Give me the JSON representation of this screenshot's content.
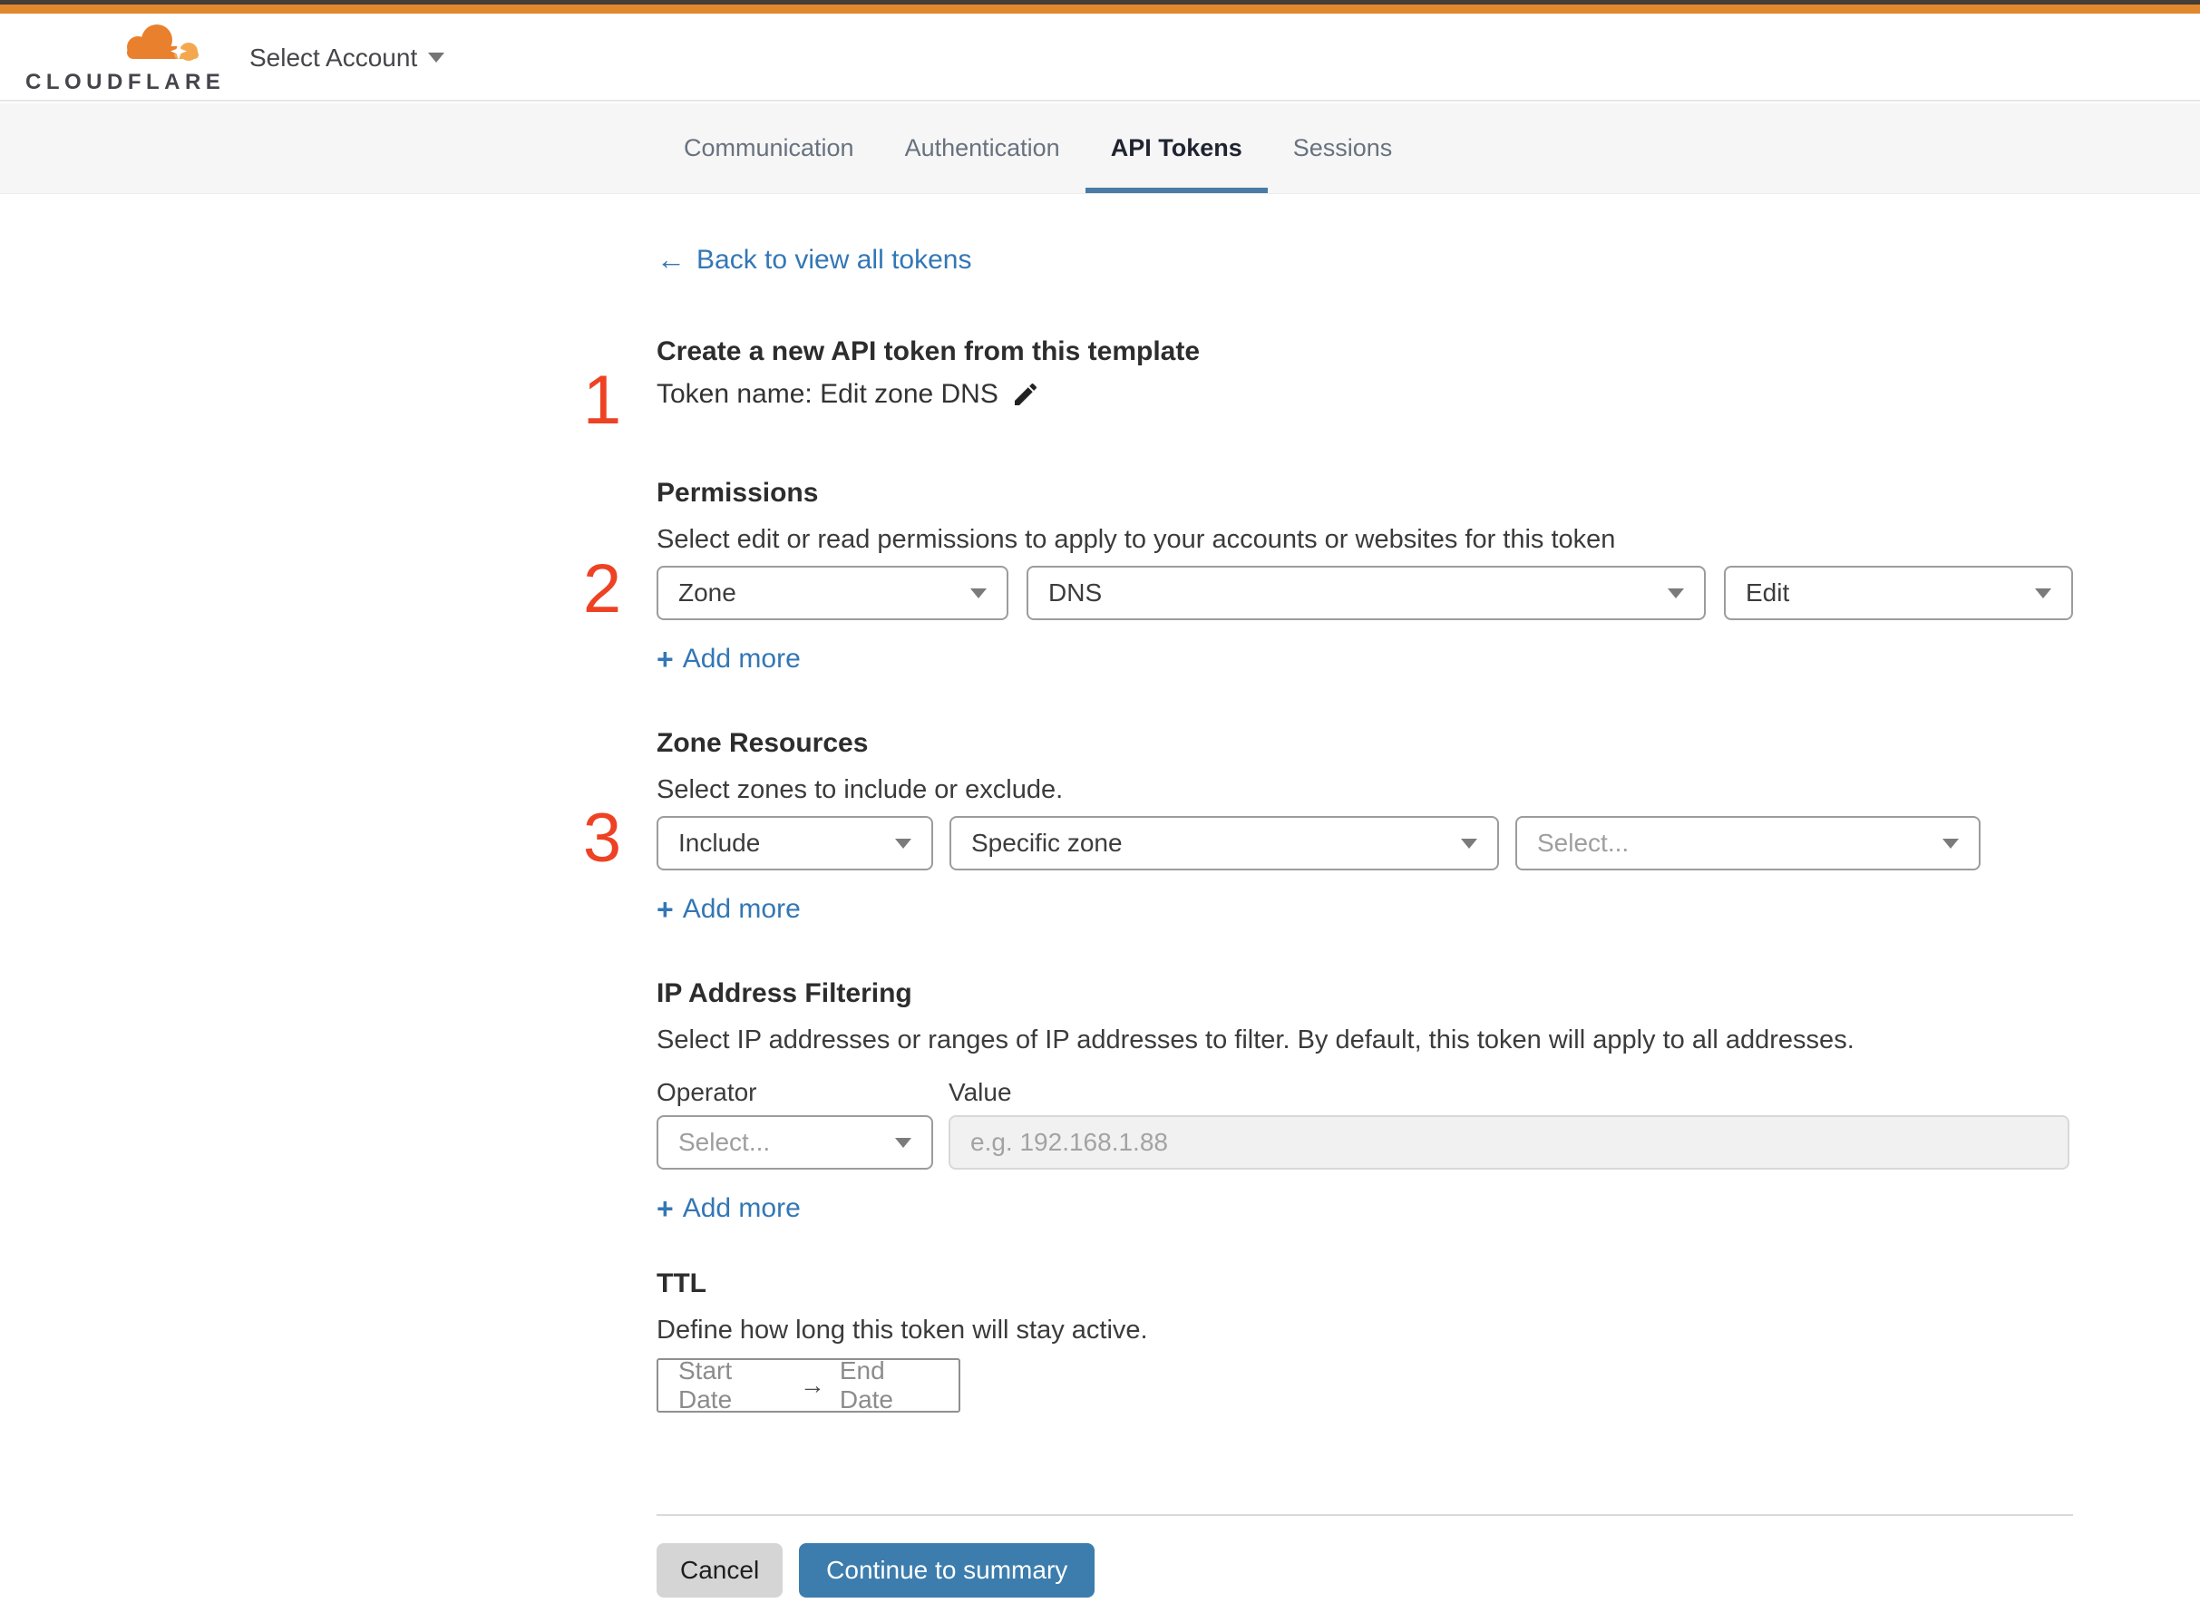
{
  "header": {
    "logo_text": "CLOUDFLARE",
    "account_selector_label": "Select Account"
  },
  "tabs": [
    {
      "label": "Communication",
      "active": false
    },
    {
      "label": "Authentication",
      "active": false
    },
    {
      "label": "API Tokens",
      "active": true
    },
    {
      "label": "Sessions",
      "active": false
    }
  ],
  "back_link": {
    "arrow": "←",
    "label": "Back to view all tokens"
  },
  "token_template": {
    "step": "1",
    "title": "Create a new API token from this template",
    "token_name": "Token name: Edit zone DNS"
  },
  "permissions": {
    "step": "2",
    "title": "Permissions",
    "description": "Select edit or read permissions to apply to your accounts or websites for this token",
    "scope_value": "Zone",
    "resource_value": "DNS",
    "access_value": "Edit",
    "add_more": {
      "plus": "+",
      "label": "Add more"
    }
  },
  "zone_resources": {
    "step": "3",
    "title": "Zone Resources",
    "description": "Select zones to include or exclude.",
    "mode_value": "Include",
    "type_value": "Specific zone",
    "zone_placeholder": "Select...",
    "add_more": {
      "plus": "+",
      "label": "Add more"
    }
  },
  "ip_filtering": {
    "title": "IP Address Filtering",
    "description": "Select IP addresses or ranges of IP addresses to filter. By default, this token will apply to all addresses.",
    "operator_label": "Operator",
    "value_label": "Value",
    "operator_placeholder": "Select...",
    "value_placeholder": "e.g. 192.168.1.88",
    "add_more": {
      "plus": "+",
      "label": "Add more"
    }
  },
  "ttl": {
    "title": "TTL",
    "description": "Define how long this token will stay active.",
    "start_placeholder": "Start Date",
    "arrow": "→",
    "end_placeholder": "End Date"
  },
  "actions": {
    "cancel_label": "Cancel",
    "continue_label": "Continue to summary"
  },
  "colors": {
    "brand_orange": "#e1872e",
    "accent_blue": "#3377b5",
    "tab_underline": "#4a7ba6",
    "step_red": "#ee4224",
    "button_blue": "#3c7dad"
  }
}
